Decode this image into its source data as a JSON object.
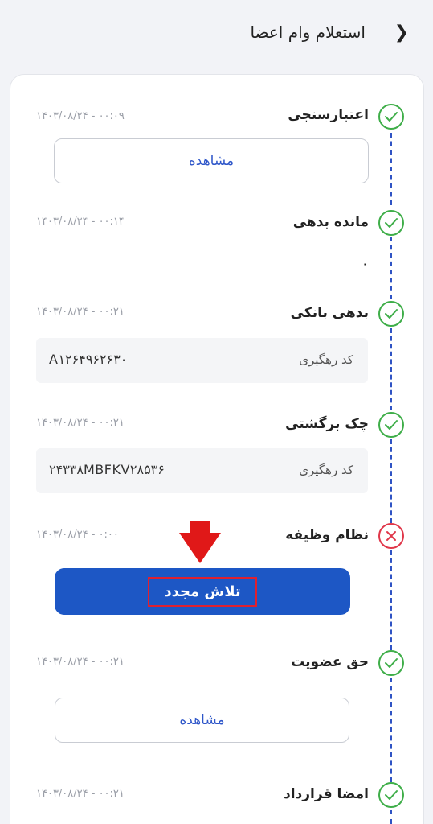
{
  "header": {
    "title": "استعلام وام اعضا",
    "back_icon": "chevron-right-icon"
  },
  "steps": [
    {
      "title": "اعتبارسنجی",
      "date": "۱۴۰۳/۰۸/۲۴ - ۰۰:۰۹",
      "status": "success"
    },
    {
      "title": "مانده بدهی",
      "date": "۱۴۰۳/۰۸/۲۴ - ۰۰:۱۴",
      "status": "success",
      "value": "۰"
    },
    {
      "title": "بدهی بانکی",
      "date": "۱۴۰۳/۰۸/۲۴ - ۰۰:۲۱",
      "status": "success",
      "tracking_label": "کد رهگیری",
      "tracking_code": "A۱۲۶۴۹۶۲۶۳۰"
    },
    {
      "title": "چک برگشتی",
      "date": "۱۴۰۳/۰۸/۲۴ - ۰۰:۲۱",
      "status": "success",
      "tracking_label": "کد رهگیری",
      "tracking_code": "۲۴۳۳۸MBFKV۲۸۵۳۶"
    },
    {
      "title": "نظام وظیفه",
      "date": "۱۴۰۳/۰۸/۲۴ - ۰:۰۰",
      "status": "error",
      "action_label": "تلاش مجدد"
    },
    {
      "title": "حق عضویت",
      "date": "۱۴۰۳/۰۸/۲۴ - ۰۰:۲۱",
      "status": "success"
    },
    {
      "title": "امضا قرارداد",
      "date": "۱۴۰۳/۰۸/۲۴ - ۰۰:۲۱",
      "status": "success"
    }
  ],
  "view_button_label": "مشاهده",
  "colors": {
    "success": "#3fae49",
    "error": "#e0374a",
    "primary": "#1d57c5",
    "timeline": "#2f53c4"
  }
}
